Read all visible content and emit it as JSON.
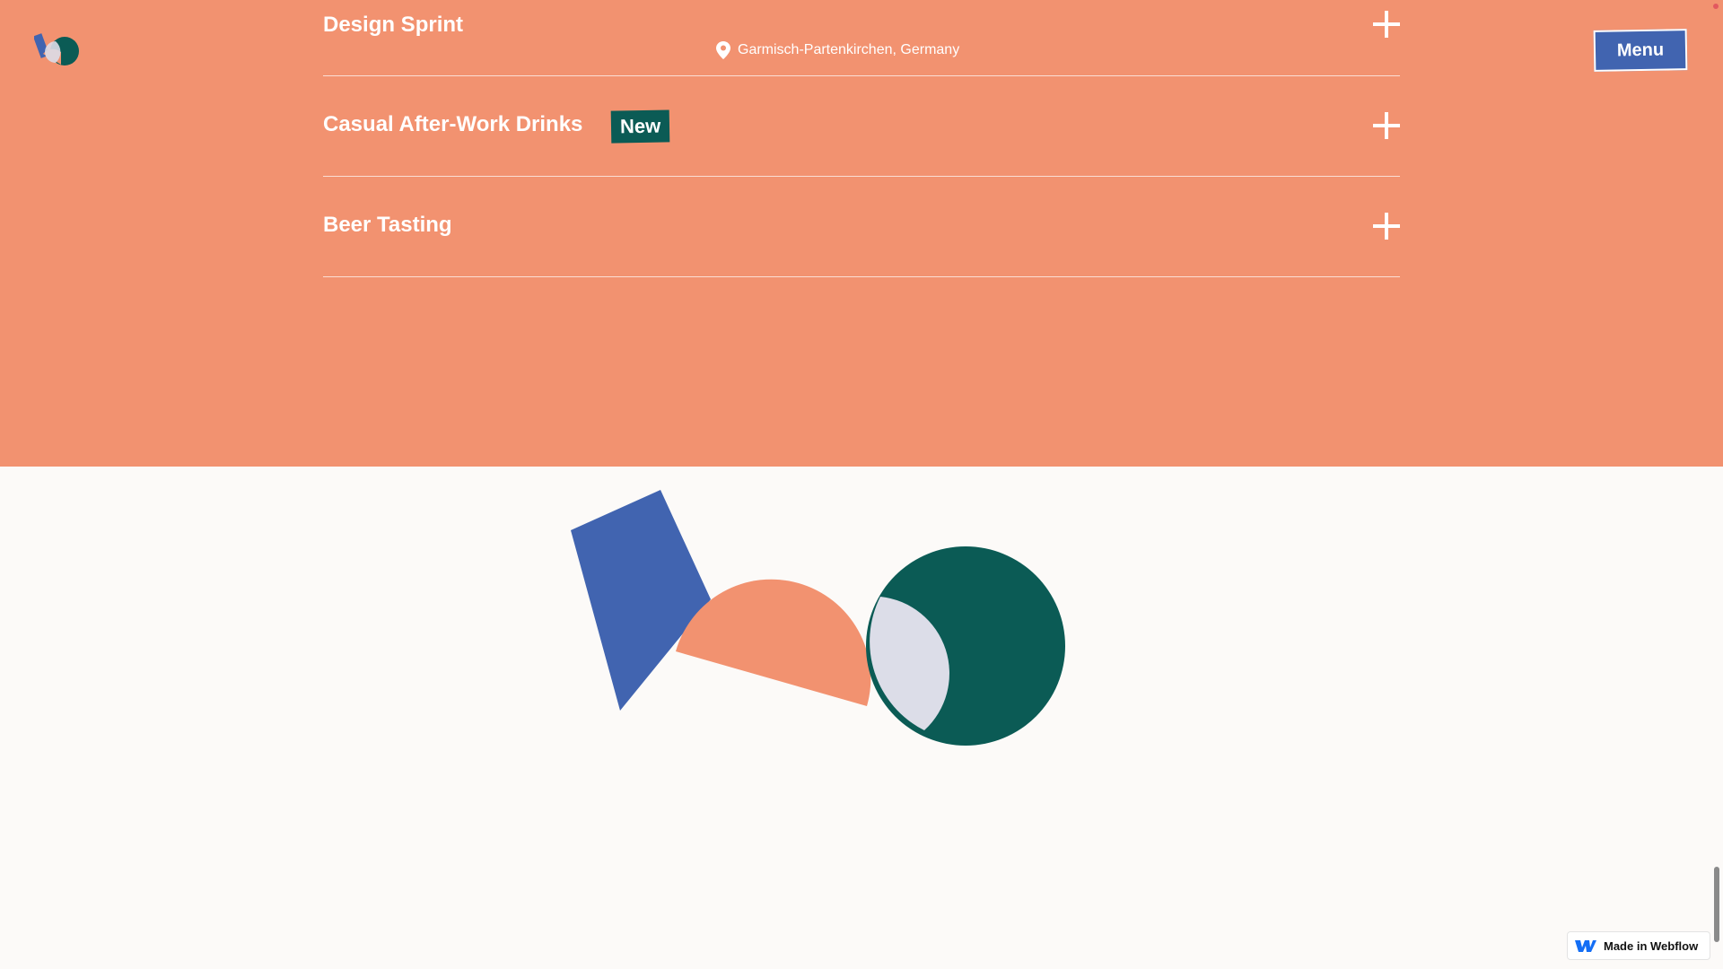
{
  "colors": {
    "orange": "#f29270",
    "blue": "#4164b0",
    "green": "#0b5b55",
    "lavender": "#dcdde8",
    "background": "#fcfaf8"
  },
  "header": {
    "logo_icon": "shapes-logo-icon",
    "menu_label": "Menu"
  },
  "events": [
    {
      "title": "Design Sprint",
      "location": "Garmisch-Partenkirchen, Germany",
      "location_icon": "map-pin-icon",
      "toggle_icon": "plus-icon"
    },
    {
      "title": "Casual After-Work Drinks",
      "badge": "New",
      "toggle_icon": "plus-icon"
    },
    {
      "title": "Beer Tasting",
      "toggle_icon": "plus-icon"
    }
  ],
  "footer": {
    "webflow_badge_label": "Made in Webflow",
    "webflow_icon": "webflow-logo-icon"
  }
}
